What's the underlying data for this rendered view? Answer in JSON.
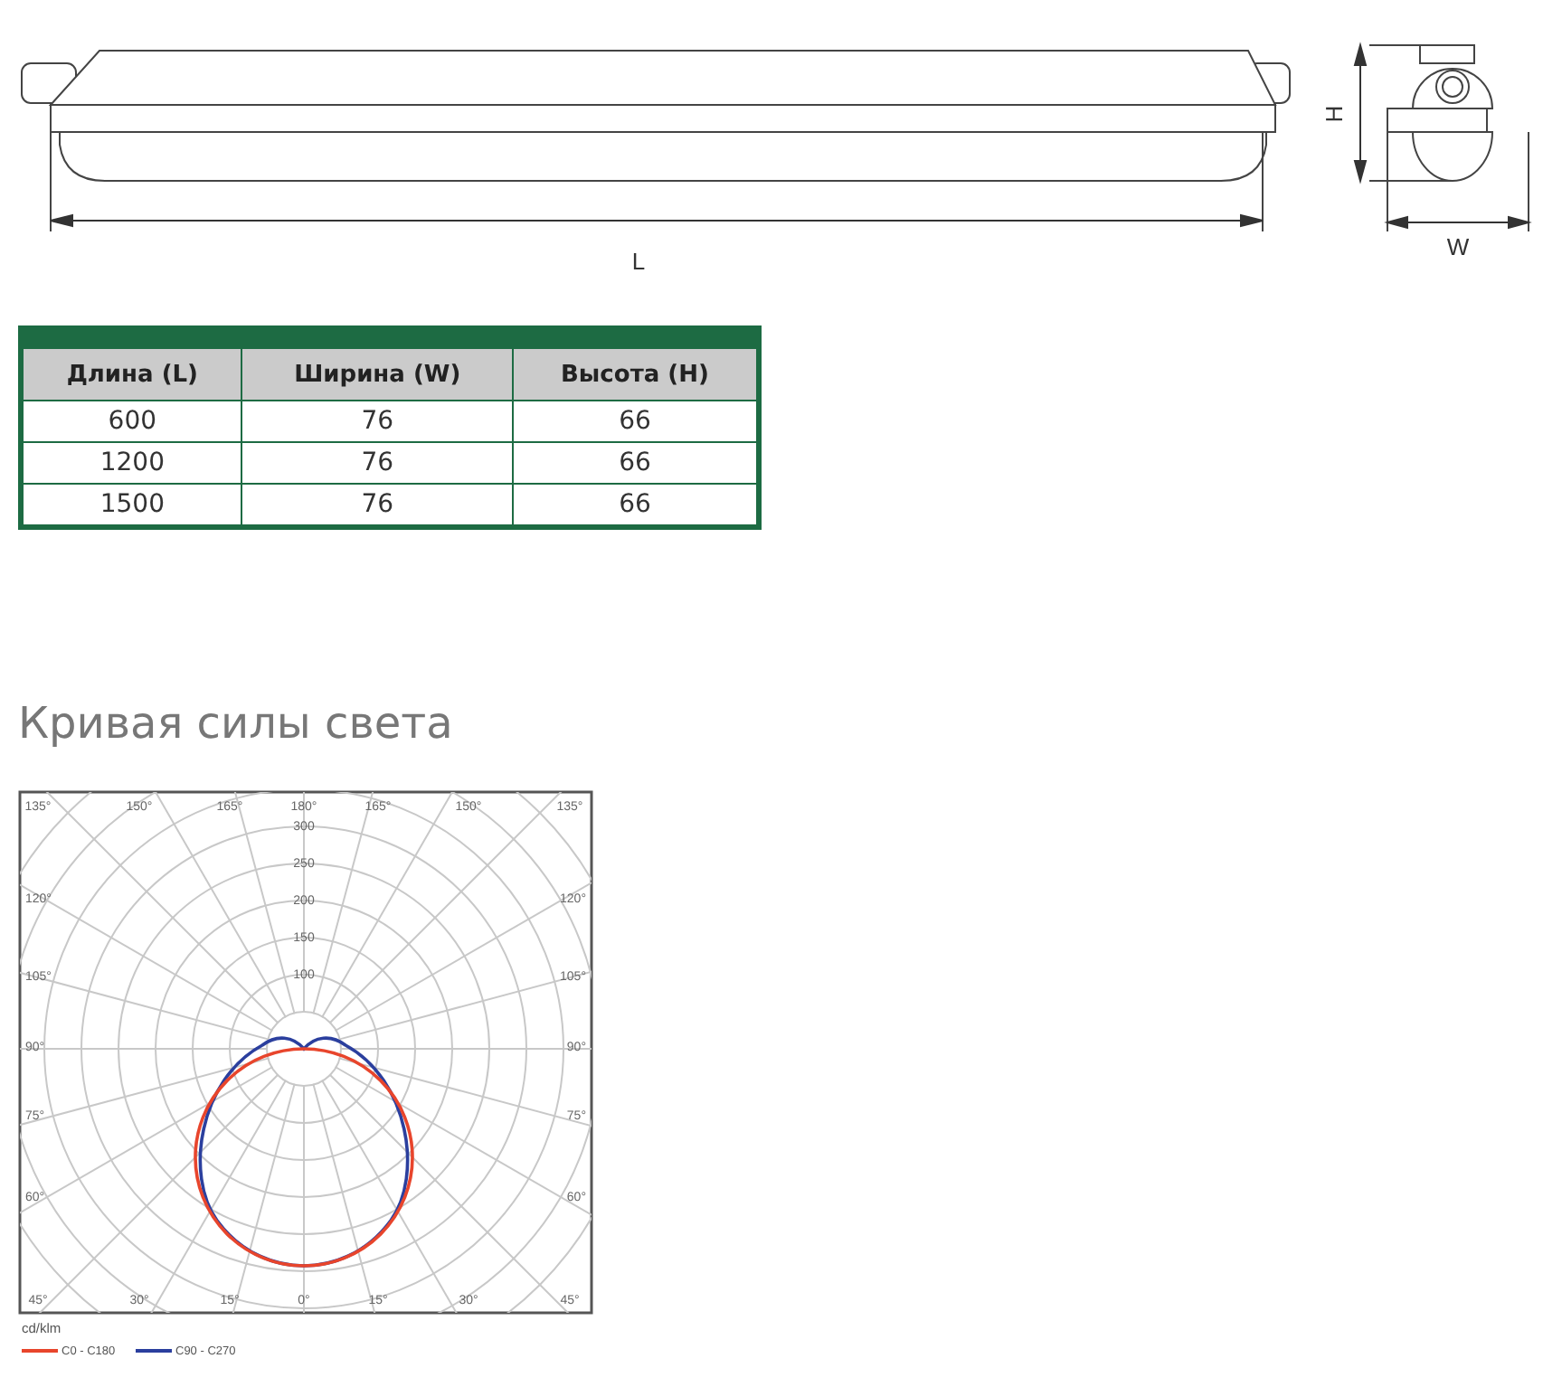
{
  "dimensions_drawing": {
    "length_label": "L",
    "height_label": "H",
    "width_label": "W"
  },
  "dimensions_table": {
    "columns": [
      "Длина (L)",
      "Ширина (W)",
      "Высота (H)"
    ],
    "rows": [
      [
        "600",
        "76",
        "66"
      ],
      [
        "1200",
        "76",
        "66"
      ],
      [
        "1500",
        "76",
        "66"
      ]
    ]
  },
  "section_title": "Кривая силы света",
  "polar_diagram": {
    "top_angle_labels": [
      "135°",
      "150°",
      "165°",
      "180°",
      "165°",
      "150°",
      "135°"
    ],
    "left_angle_labels": [
      "120°",
      "105°",
      "90°",
      "75°",
      "60°"
    ],
    "right_angle_labels": [
      "120°",
      "105°",
      "90°",
      "75°",
      "60°"
    ],
    "bottom_angle_labels": [
      "45°",
      "30°",
      "15°",
      "0°",
      "15°",
      "30°",
      "45°"
    ],
    "ring_labels": [
      "300",
      "250",
      "200",
      "150",
      "100"
    ],
    "unit": "cd/klm",
    "legend": [
      {
        "name": "C0 - C180",
        "color": "#e8452c"
      },
      {
        "name": "C90 - C270",
        "color": "#2b3f9e"
      }
    ]
  }
}
